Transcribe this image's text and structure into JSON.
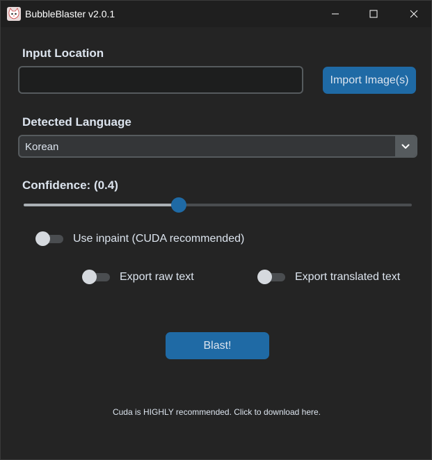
{
  "window": {
    "title": "BubbleBlaster v2.0.1",
    "icons": {
      "app": "cat-face-icon",
      "minimize": "minimize-icon",
      "maximize": "maximize-icon",
      "close": "close-icon"
    }
  },
  "input_location": {
    "label": "Input Location",
    "value": "",
    "placeholder": "",
    "import_button": "Import Image(s)"
  },
  "language": {
    "label": "Detected Language",
    "selected": "Korean",
    "icon": "chevron-down-icon"
  },
  "confidence": {
    "label": "Confidence: (0.4)",
    "value": 0.4,
    "min": 0,
    "max": 1
  },
  "toggles": {
    "inpaint": {
      "label": "Use inpaint (CUDA recommended)",
      "on": false
    },
    "export_raw": {
      "label": "Export raw text",
      "on": false
    },
    "export_translated": {
      "label": "Export translated text",
      "on": false
    }
  },
  "blast_button": "Blast!",
  "footer_text": "Cuda is HIGHLY recommended. Click to download here.",
  "colors": {
    "background": "#242424",
    "accent": "#1f6aa5",
    "text": "#dce4ee"
  }
}
